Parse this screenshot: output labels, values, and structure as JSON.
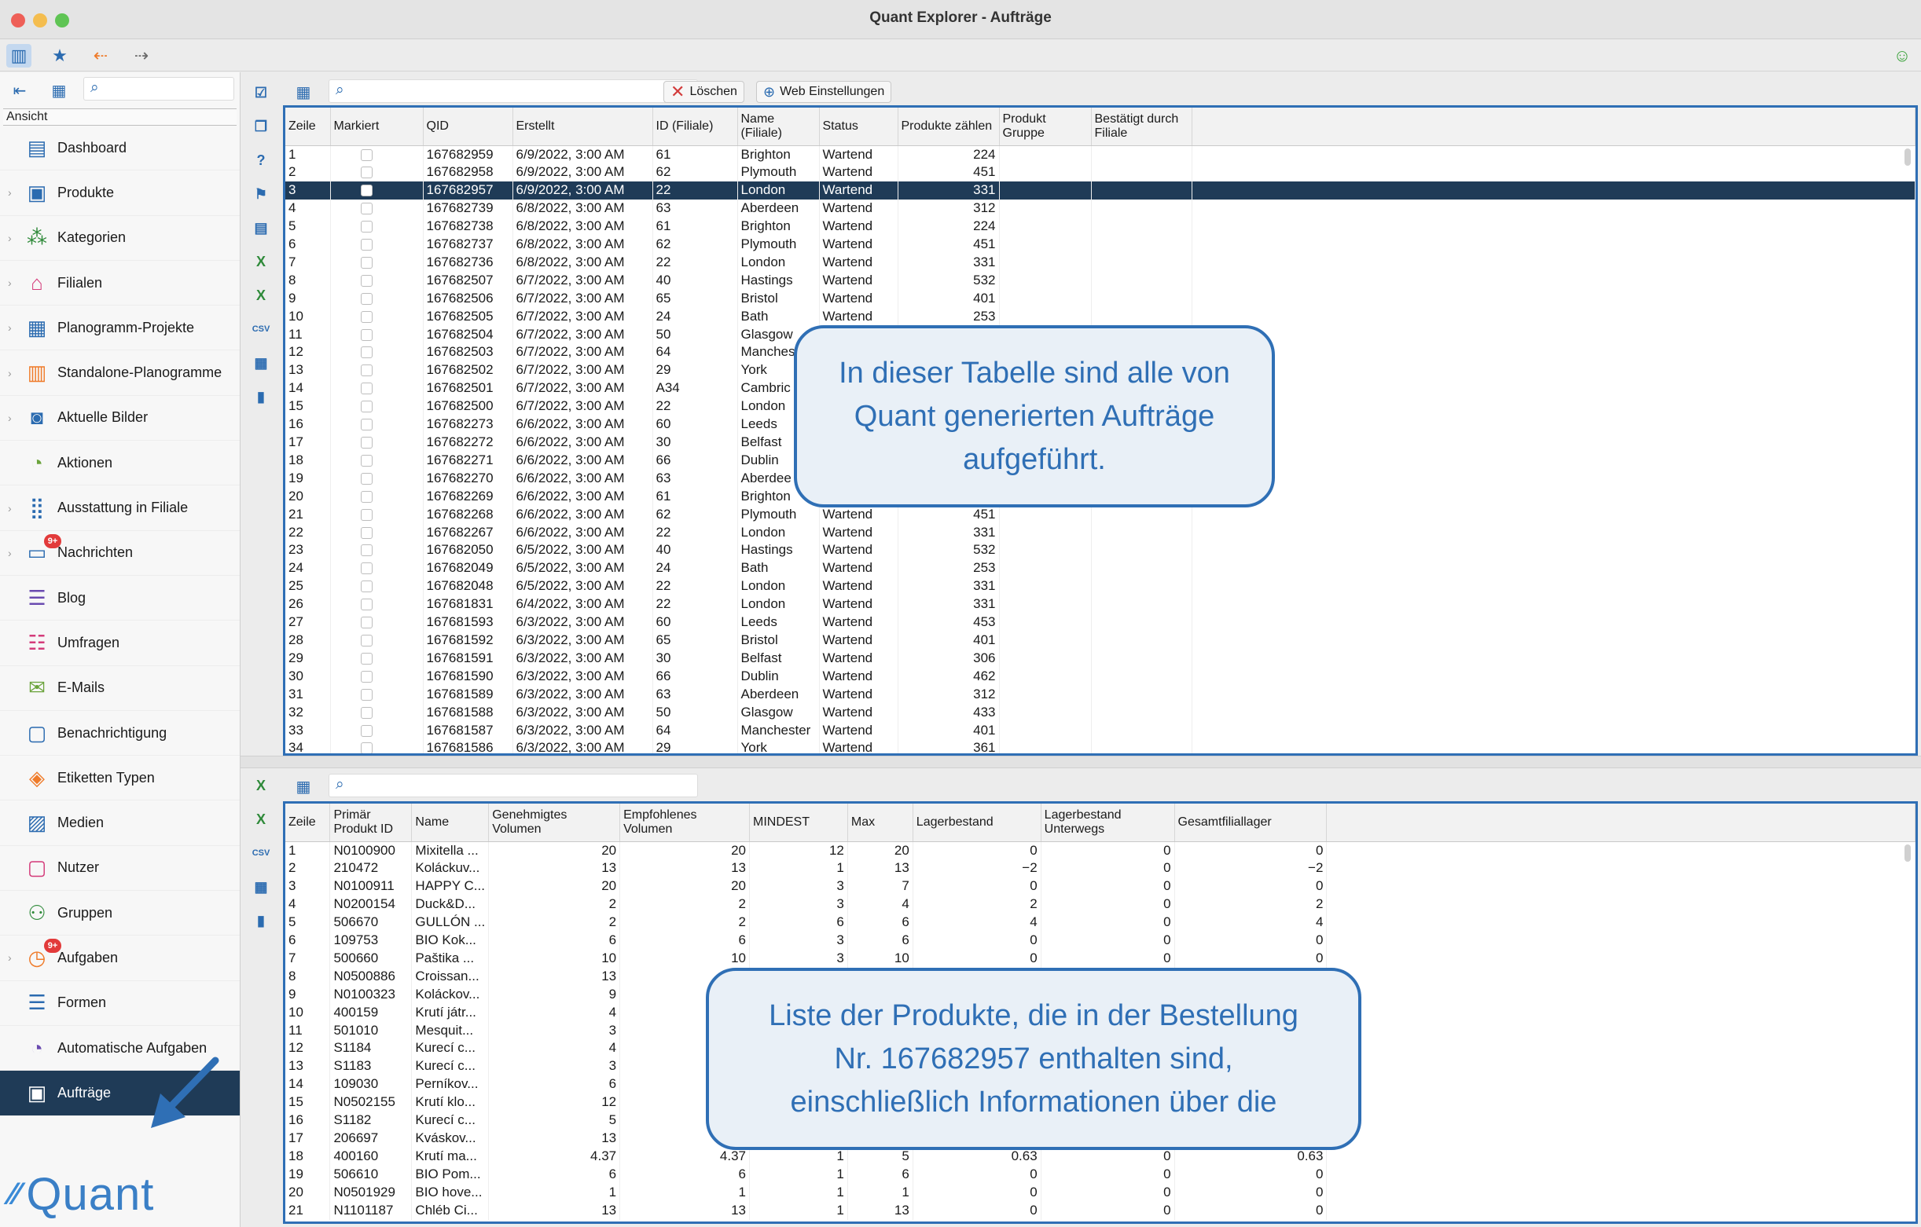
{
  "window": {
    "title": "Quant Explorer - Aufträge"
  },
  "sidebar": {
    "heading": "Ansicht",
    "items": [
      {
        "label": "Dashboard",
        "icon": "dashboard-icon",
        "chev": false
      },
      {
        "label": "Produkte",
        "icon": "product-icon",
        "chev": true
      },
      {
        "label": "Kategorien",
        "icon": "categories-icon",
        "chev": true
      },
      {
        "label": "Filialen",
        "icon": "store-icon",
        "chev": true
      },
      {
        "label": "Planogramm-Projekte",
        "icon": "planogram-projects-icon",
        "chev": true
      },
      {
        "label": "Standalone-Planogramme",
        "icon": "standalone-planogram-icon",
        "chev": true
      },
      {
        "label": "Aktuelle Bilder",
        "icon": "camera-icon",
        "chev": true
      },
      {
        "label": "Aktionen",
        "icon": "actions-icon",
        "chev": false
      },
      {
        "label": "Ausstattung in Filiale",
        "icon": "equipment-icon",
        "chev": true
      },
      {
        "label": "Nachrichten",
        "icon": "messages-icon",
        "chev": true,
        "badge": "9+"
      },
      {
        "label": "Blog",
        "icon": "blog-icon",
        "chev": false
      },
      {
        "label": "Umfragen",
        "icon": "survey-icon",
        "chev": false
      },
      {
        "label": "E-Mails",
        "icon": "mail-icon",
        "chev": false
      },
      {
        "label": "Benachrichtigung",
        "icon": "notification-icon",
        "chev": false
      },
      {
        "label": "Etiketten Typen",
        "icon": "labels-icon",
        "chev": false
      },
      {
        "label": "Medien",
        "icon": "media-icon",
        "chev": false
      },
      {
        "label": "Nutzer",
        "icon": "user-icon",
        "chev": false
      },
      {
        "label": "Gruppen",
        "icon": "groups-icon",
        "chev": false
      },
      {
        "label": "Aufgaben",
        "icon": "tasks-icon",
        "chev": true,
        "badge": "9+"
      },
      {
        "label": "Formen",
        "icon": "forms-icon",
        "chev": false
      },
      {
        "label": "Automatische Aufgaben",
        "icon": "auto-tasks-icon",
        "chev": false
      },
      {
        "label": "Aufträge",
        "icon": "orders-icon",
        "chev": false,
        "active": true
      }
    ],
    "logo_text": "Quant"
  },
  "orders_toolbar": {
    "delete_label": "Löschen",
    "web_settings_label": "Web Einstellungen"
  },
  "orders": {
    "columns": [
      "Zeile",
      "Markiert",
      "QID",
      "Erstellt",
      "ID (Filiale)",
      "Name (Filiale)",
      "Status",
      "Produkte zählen",
      "Produkt Gruppe",
      "Bestätigt durch Filiale"
    ],
    "selected_row": 3,
    "rows": [
      [
        "1",
        "167682959",
        "6/9/2022, 3:00 AM",
        "61",
        "Brighton",
        "Wartend",
        "224"
      ],
      [
        "2",
        "167682958",
        "6/9/2022, 3:00 AM",
        "62",
        "Plymouth",
        "Wartend",
        "451"
      ],
      [
        "3",
        "167682957",
        "6/9/2022, 3:00 AM",
        "22",
        "London",
        "Wartend",
        "331"
      ],
      [
        "4",
        "167682739",
        "6/8/2022, 3:00 AM",
        "63",
        "Aberdeen",
        "Wartend",
        "312"
      ],
      [
        "5",
        "167682738",
        "6/8/2022, 3:00 AM",
        "61",
        "Brighton",
        "Wartend",
        "224"
      ],
      [
        "6",
        "167682737",
        "6/8/2022, 3:00 AM",
        "62",
        "Plymouth",
        "Wartend",
        "451"
      ],
      [
        "7",
        "167682736",
        "6/8/2022, 3:00 AM",
        "22",
        "London",
        "Wartend",
        "331"
      ],
      [
        "8",
        "167682507",
        "6/7/2022, 3:00 AM",
        "40",
        "Hastings",
        "Wartend",
        "532"
      ],
      [
        "9",
        "167682506",
        "6/7/2022, 3:00 AM",
        "65",
        "Bristol",
        "Wartend",
        "401"
      ],
      [
        "10",
        "167682505",
        "6/7/2022, 3:00 AM",
        "24",
        "Bath",
        "Wartend",
        "253"
      ],
      [
        "11",
        "167682504",
        "6/7/2022, 3:00 AM",
        "50",
        "Glasgow",
        "",
        ""
      ],
      [
        "12",
        "167682503",
        "6/7/2022, 3:00 AM",
        "64",
        "Manches",
        "",
        ""
      ],
      [
        "13",
        "167682502",
        "6/7/2022, 3:00 AM",
        "29",
        "York",
        "",
        ""
      ],
      [
        "14",
        "167682501",
        "6/7/2022, 3:00 AM",
        "A34",
        "Cambric",
        "",
        ""
      ],
      [
        "15",
        "167682500",
        "6/7/2022, 3:00 AM",
        "22",
        "London",
        "",
        ""
      ],
      [
        "16",
        "167682273",
        "6/6/2022, 3:00 AM",
        "60",
        "Leeds",
        "",
        ""
      ],
      [
        "17",
        "167682272",
        "6/6/2022, 3:00 AM",
        "30",
        "Belfast",
        "",
        ""
      ],
      [
        "18",
        "167682271",
        "6/6/2022, 3:00 AM",
        "66",
        "Dublin",
        "",
        ""
      ],
      [
        "19",
        "167682270",
        "6/6/2022, 3:00 AM",
        "63",
        "Aberdee",
        "",
        ""
      ],
      [
        "20",
        "167682269",
        "6/6/2022, 3:00 AM",
        "61",
        "Brighton",
        "",
        ""
      ],
      [
        "21",
        "167682268",
        "6/6/2022, 3:00 AM",
        "62",
        "Plymouth",
        "Wartend",
        "451"
      ],
      [
        "22",
        "167682267",
        "6/6/2022, 3:00 AM",
        "22",
        "London",
        "Wartend",
        "331"
      ],
      [
        "23",
        "167682050",
        "6/5/2022, 3:00 AM",
        "40",
        "Hastings",
        "Wartend",
        "532"
      ],
      [
        "24",
        "167682049",
        "6/5/2022, 3:00 AM",
        "24",
        "Bath",
        "Wartend",
        "253"
      ],
      [
        "25",
        "167682048",
        "6/5/2022, 3:00 AM",
        "22",
        "London",
        "Wartend",
        "331"
      ],
      [
        "26",
        "167681831",
        "6/4/2022, 3:00 AM",
        "22",
        "London",
        "Wartend",
        "331"
      ],
      [
        "27",
        "167681593",
        "6/3/2022, 3:00 AM",
        "60",
        "Leeds",
        "Wartend",
        "453"
      ],
      [
        "28",
        "167681592",
        "6/3/2022, 3:00 AM",
        "65",
        "Bristol",
        "Wartend",
        "401"
      ],
      [
        "29",
        "167681591",
        "6/3/2022, 3:00 AM",
        "30",
        "Belfast",
        "Wartend",
        "306"
      ],
      [
        "30",
        "167681590",
        "6/3/2022, 3:00 AM",
        "66",
        "Dublin",
        "Wartend",
        "462"
      ],
      [
        "31",
        "167681589",
        "6/3/2022, 3:00 AM",
        "63",
        "Aberdeen",
        "Wartend",
        "312"
      ],
      [
        "32",
        "167681588",
        "6/3/2022, 3:00 AM",
        "50",
        "Glasgow",
        "Wartend",
        "433"
      ],
      [
        "33",
        "167681587",
        "6/3/2022, 3:00 AM",
        "64",
        "Manchester",
        "Wartend",
        "401"
      ],
      [
        "34",
        "167681586",
        "6/3/2022, 3:00 AM",
        "29",
        "York",
        "Wartend",
        "361"
      ]
    ]
  },
  "products": {
    "columns": [
      "Zeile",
      "Primär Produkt ID",
      "Name",
      "Genehmigtes Volumen",
      "Empfohlenes Volumen",
      "MINDEST",
      "Max",
      "Lagerbestand",
      "Lagerbestand Unterwegs",
      "Gesamtfiliallager"
    ],
    "rows": [
      [
        "1",
        "N0100900",
        "Mixitella ...",
        "20",
        "20",
        "12",
        "20",
        "0",
        "0",
        "0"
      ],
      [
        "2",
        "210472",
        "Koláckuv...",
        "13",
        "13",
        "1",
        "13",
        "−2",
        "0",
        "−2"
      ],
      [
        "3",
        "N0100911",
        "HAPPY C...",
        "20",
        "20",
        "3",
        "7",
        "0",
        "0",
        "0"
      ],
      [
        "4",
        "N0200154",
        "Duck&D...",
        "2",
        "2",
        "3",
        "4",
        "2",
        "0",
        "2"
      ],
      [
        "5",
        "506670",
        "GULLÓN ...",
        "2",
        "2",
        "6",
        "6",
        "4",
        "0",
        "4"
      ],
      [
        "6",
        "109753",
        "BIO Kok...",
        "6",
        "6",
        "3",
        "6",
        "0",
        "0",
        "0"
      ],
      [
        "7",
        "500660",
        "Paštika ...",
        "10",
        "10",
        "3",
        "10",
        "0",
        "0",
        "0"
      ],
      [
        "8",
        "N0500886",
        "Croissan...",
        "13",
        "",
        "",
        "",
        "",
        "",
        ""
      ],
      [
        "9",
        "N0100323",
        "Koláckov...",
        "9",
        "",
        "",
        "",
        "",
        "",
        ""
      ],
      [
        "10",
        "400159",
        "Krutí játr...",
        "4",
        "",
        "",
        "",
        "",
        "",
        ""
      ],
      [
        "11",
        "501010",
        "Mesquit...",
        "3",
        "",
        "",
        "",
        "",
        "",
        ""
      ],
      [
        "12",
        "S1184",
        "Kurecí c...",
        "4",
        "",
        "",
        "",
        "",
        "",
        ""
      ],
      [
        "13",
        "S1183",
        "Kurecí c...",
        "3",
        "",
        "",
        "",
        "",
        "",
        ""
      ],
      [
        "14",
        "109030",
        "Perníkov...",
        "6",
        "",
        "",
        "",
        "",
        "",
        ""
      ],
      [
        "15",
        "N0502155",
        "Krutí klo...",
        "12",
        "",
        "",
        "",
        "",
        "",
        ""
      ],
      [
        "16",
        "S1182",
        "Kurecí c...",
        "5",
        "",
        "",
        "",
        "",
        "",
        ""
      ],
      [
        "17",
        "206697",
        "Kváskov...",
        "13",
        "",
        "",
        "",
        "",
        "",
        ""
      ],
      [
        "18",
        "400160",
        "Krutí ma...",
        "4.37",
        "4.37",
        "1",
        "5",
        "0.63",
        "0",
        "0.63"
      ],
      [
        "19",
        "506610",
        "BIO Pom...",
        "6",
        "6",
        "1",
        "6",
        "0",
        "0",
        "0"
      ],
      [
        "20",
        "N0501929",
        "BIO hove...",
        "1",
        "1",
        "1",
        "1",
        "0",
        "0",
        "0"
      ],
      [
        "21",
        "N1101187",
        "Chléb Ci...",
        "13",
        "13",
        "1",
        "13",
        "0",
        "0",
        "0"
      ]
    ]
  },
  "callouts": {
    "top": "In dieser Tabelle sind alle von Quant generierten Aufträge aufgeführt.",
    "bottom": "Liste der Produkte, die in der Bestellung Nr. 167682957 enthalten sind, einschließlich Informationen über die"
  },
  "colors": {
    "accent": "#2f6fb5",
    "selected_row": "#1f3b57",
    "callout_bg": "#e9f0f7"
  }
}
